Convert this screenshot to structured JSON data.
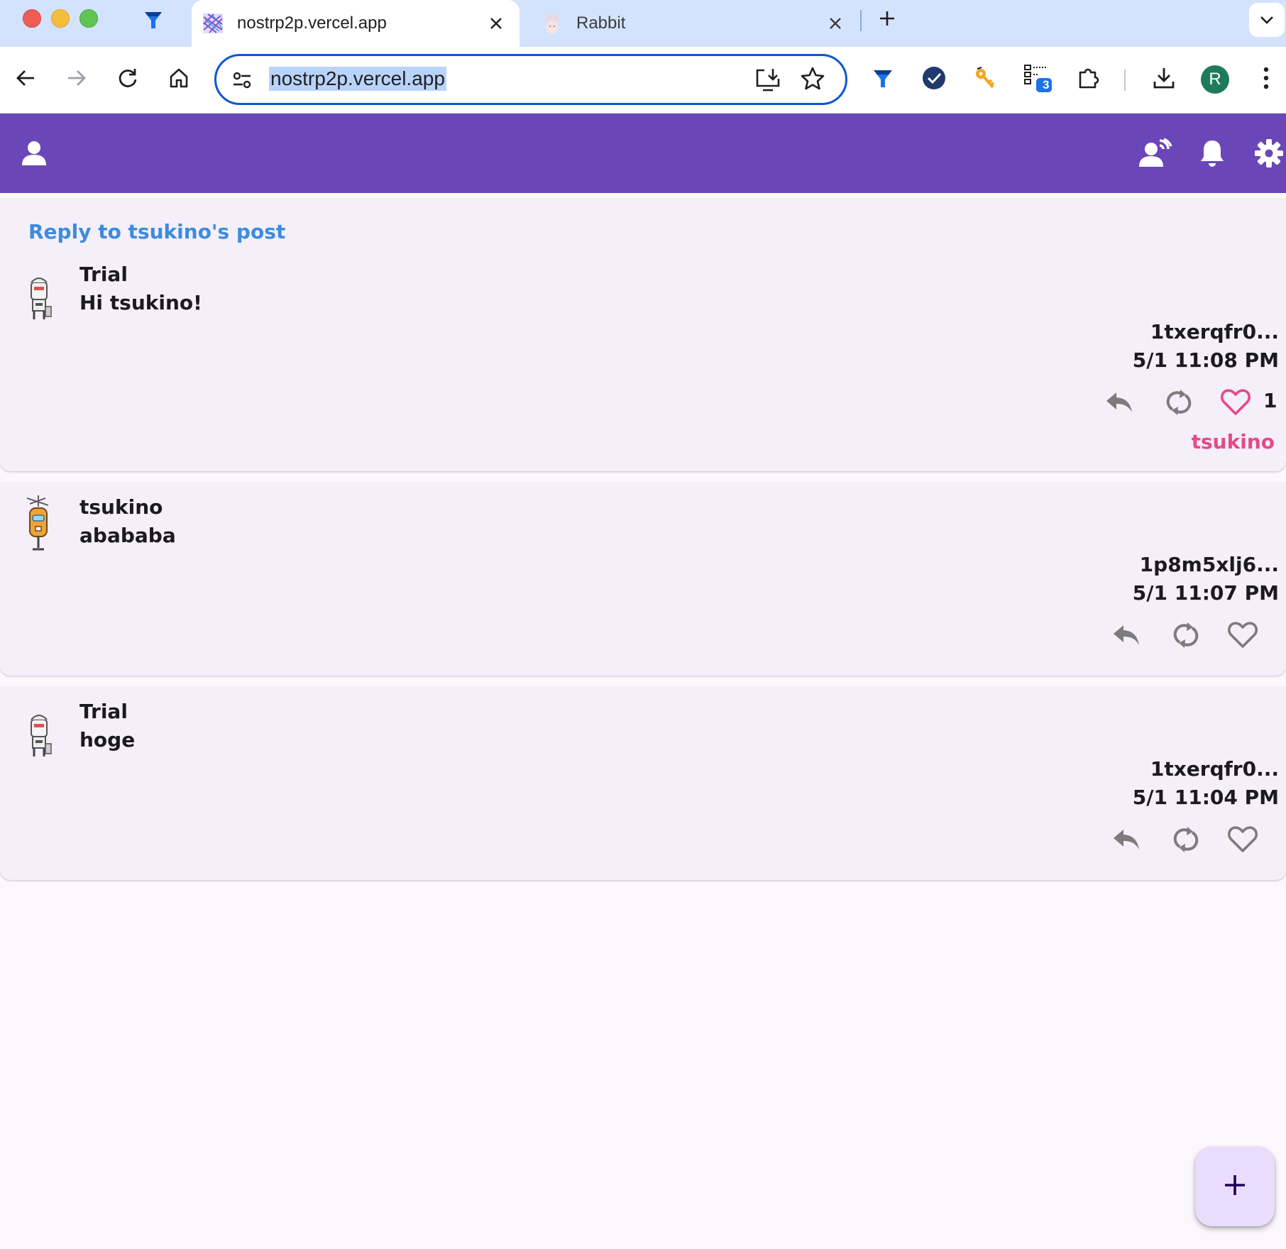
{
  "browser": {
    "tabs": [
      {
        "title": "nostrp2p.vercel.app",
        "active": true
      },
      {
        "title": "Rabbit",
        "active": false
      }
    ],
    "omnibox": {
      "url": "nostrp2p.vercel.app"
    },
    "profile_initial": "R",
    "extension_badge": "3"
  },
  "app": {
    "accent_color": "#6a46b8",
    "header_icons": [
      "person-icon",
      "relay-person-icon",
      "bell-icon",
      "settings-gear-icon"
    ],
    "posts": [
      {
        "reply_header": "Reply to tsukino's post",
        "author": "Trial",
        "content": "Hi tsukino!",
        "npub": "1txerqfr0...",
        "time": "5/1 11:08 PM",
        "liked": true,
        "like_count": "1",
        "liked_by": "tsukino"
      },
      {
        "author": "tsukino",
        "content": "abababa",
        "npub": "1p8m5xlj6...",
        "time": "5/1 11:07 PM",
        "liked": false
      },
      {
        "author": "Trial",
        "content": "hoge",
        "npub": "1txerqfr0...",
        "time": "5/1 11:04 PM",
        "liked": false
      }
    ],
    "fab_label": "+"
  }
}
